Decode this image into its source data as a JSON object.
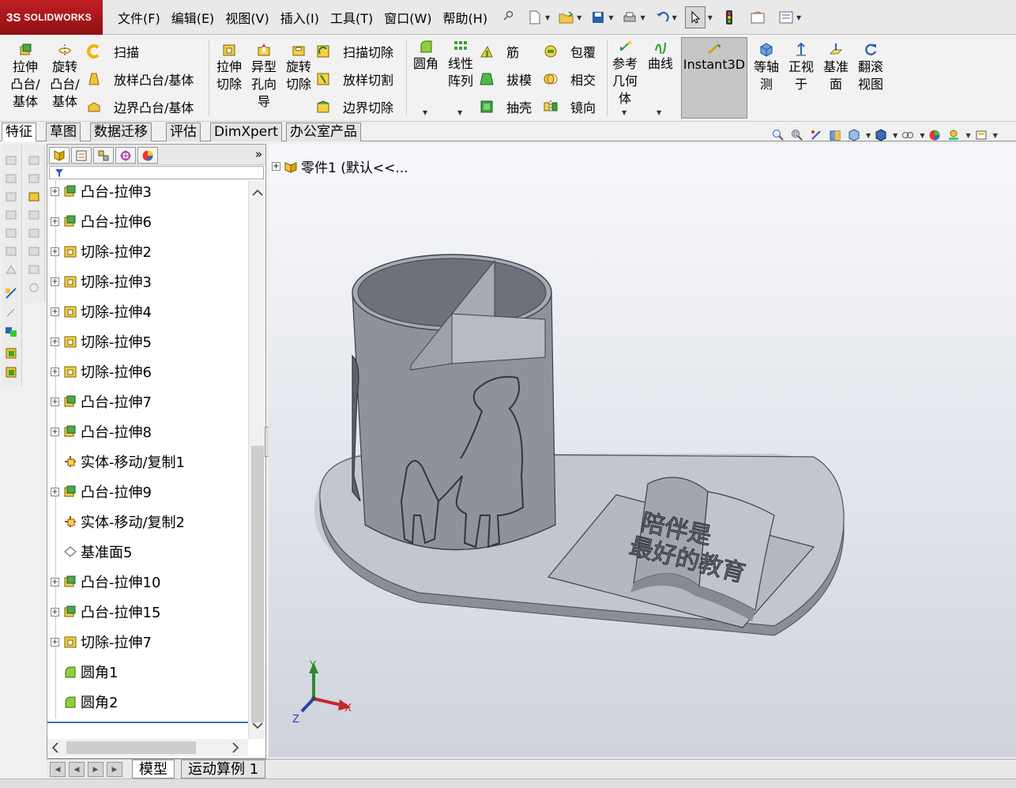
{
  "app": {
    "brand_ds": "3S",
    "brand_name": "SOLIDWORKS"
  },
  "menu": [
    "文件(F)",
    "编辑(E)",
    "视图(V)",
    "插入(I)",
    "工具(T)",
    "窗口(W)",
    "帮助(H)"
  ],
  "quick_tools": [
    "new-document-icon",
    "open-icon",
    "save-icon",
    "print-icon",
    "undo-icon",
    "select-pointer-icon",
    "rebuild-icon",
    "file-properties-icon",
    "options-icon"
  ],
  "commands": {
    "extrude_boss": "拉伸凸台/基体",
    "revolve_boss": "旋转凸台/基体",
    "sweep": "扫描",
    "loft_boss": "放样凸台/基体",
    "boundary_boss": "边界凸台/基体",
    "extrude_cut": "拉伸切除",
    "hole_wizard": "异型孔向导",
    "revolve_cut": "旋转切除",
    "sweep_cut": "扫描切除",
    "loft_cut": "放样切割",
    "boundary_cut": "边界切除",
    "fillet": "圆角",
    "linear_pattern": "线性阵列",
    "rib": "筋",
    "draft": "拔模",
    "shell": "抽壳",
    "wrap": "包覆",
    "intersect": "相交",
    "mirror": "镜向",
    "ref_geometry": "参考几何体",
    "curves": "曲线",
    "instant3d": "Instant3D",
    "isometric": "等轴测",
    "normal_to": "正视于",
    "datum": "基准面",
    "rotate_view": "翻滚视图"
  },
  "tabs": [
    "特征",
    "草图",
    "数据迁移",
    "评估",
    "DimXpert",
    "办公室产品"
  ],
  "panel": {
    "collapse_arrows": "»"
  },
  "tree": [
    {
      "label": "凸台-拉伸3",
      "type": "boss"
    },
    {
      "label": "凸台-拉伸6",
      "type": "boss"
    },
    {
      "label": "切除-拉伸2",
      "type": "cut"
    },
    {
      "label": "切除-拉伸3",
      "type": "cut"
    },
    {
      "label": "切除-拉伸4",
      "type": "cut"
    },
    {
      "label": "切除-拉伸5",
      "type": "cut"
    },
    {
      "label": "切除-拉伸6",
      "type": "cut"
    },
    {
      "label": "凸台-拉伸7",
      "type": "boss"
    },
    {
      "label": "凸台-拉伸8",
      "type": "boss"
    },
    {
      "label": "实体-移动/复制1",
      "type": "move"
    },
    {
      "label": "凸台-拉伸9",
      "type": "boss"
    },
    {
      "label": "实体-移动/复制2",
      "type": "move"
    },
    {
      "label": "基准面5",
      "type": "plane"
    },
    {
      "label": "凸台-拉伸10",
      "type": "boss"
    },
    {
      "label": "凸台-拉伸15",
      "type": "boss"
    },
    {
      "label": "切除-拉伸7",
      "type": "cut"
    },
    {
      "label": "圆角1",
      "type": "fillet"
    },
    {
      "label": "圆角2",
      "type": "fillet"
    }
  ],
  "viewport": {
    "part_label": "零件1 (默认<<...",
    "book_text_line1": "陪伴是",
    "book_text_line2": "最好的教育",
    "axis_x": "X",
    "axis_y": "Y",
    "axis_z": "Z"
  },
  "bottom_tabs": [
    "模型",
    "运动算例 1"
  ],
  "colors": {
    "brand_red": "#b5191e",
    "model_gray": "#8d9098",
    "base_gray": "#c9cbd1",
    "selection_blue": "#3d6fb5"
  }
}
